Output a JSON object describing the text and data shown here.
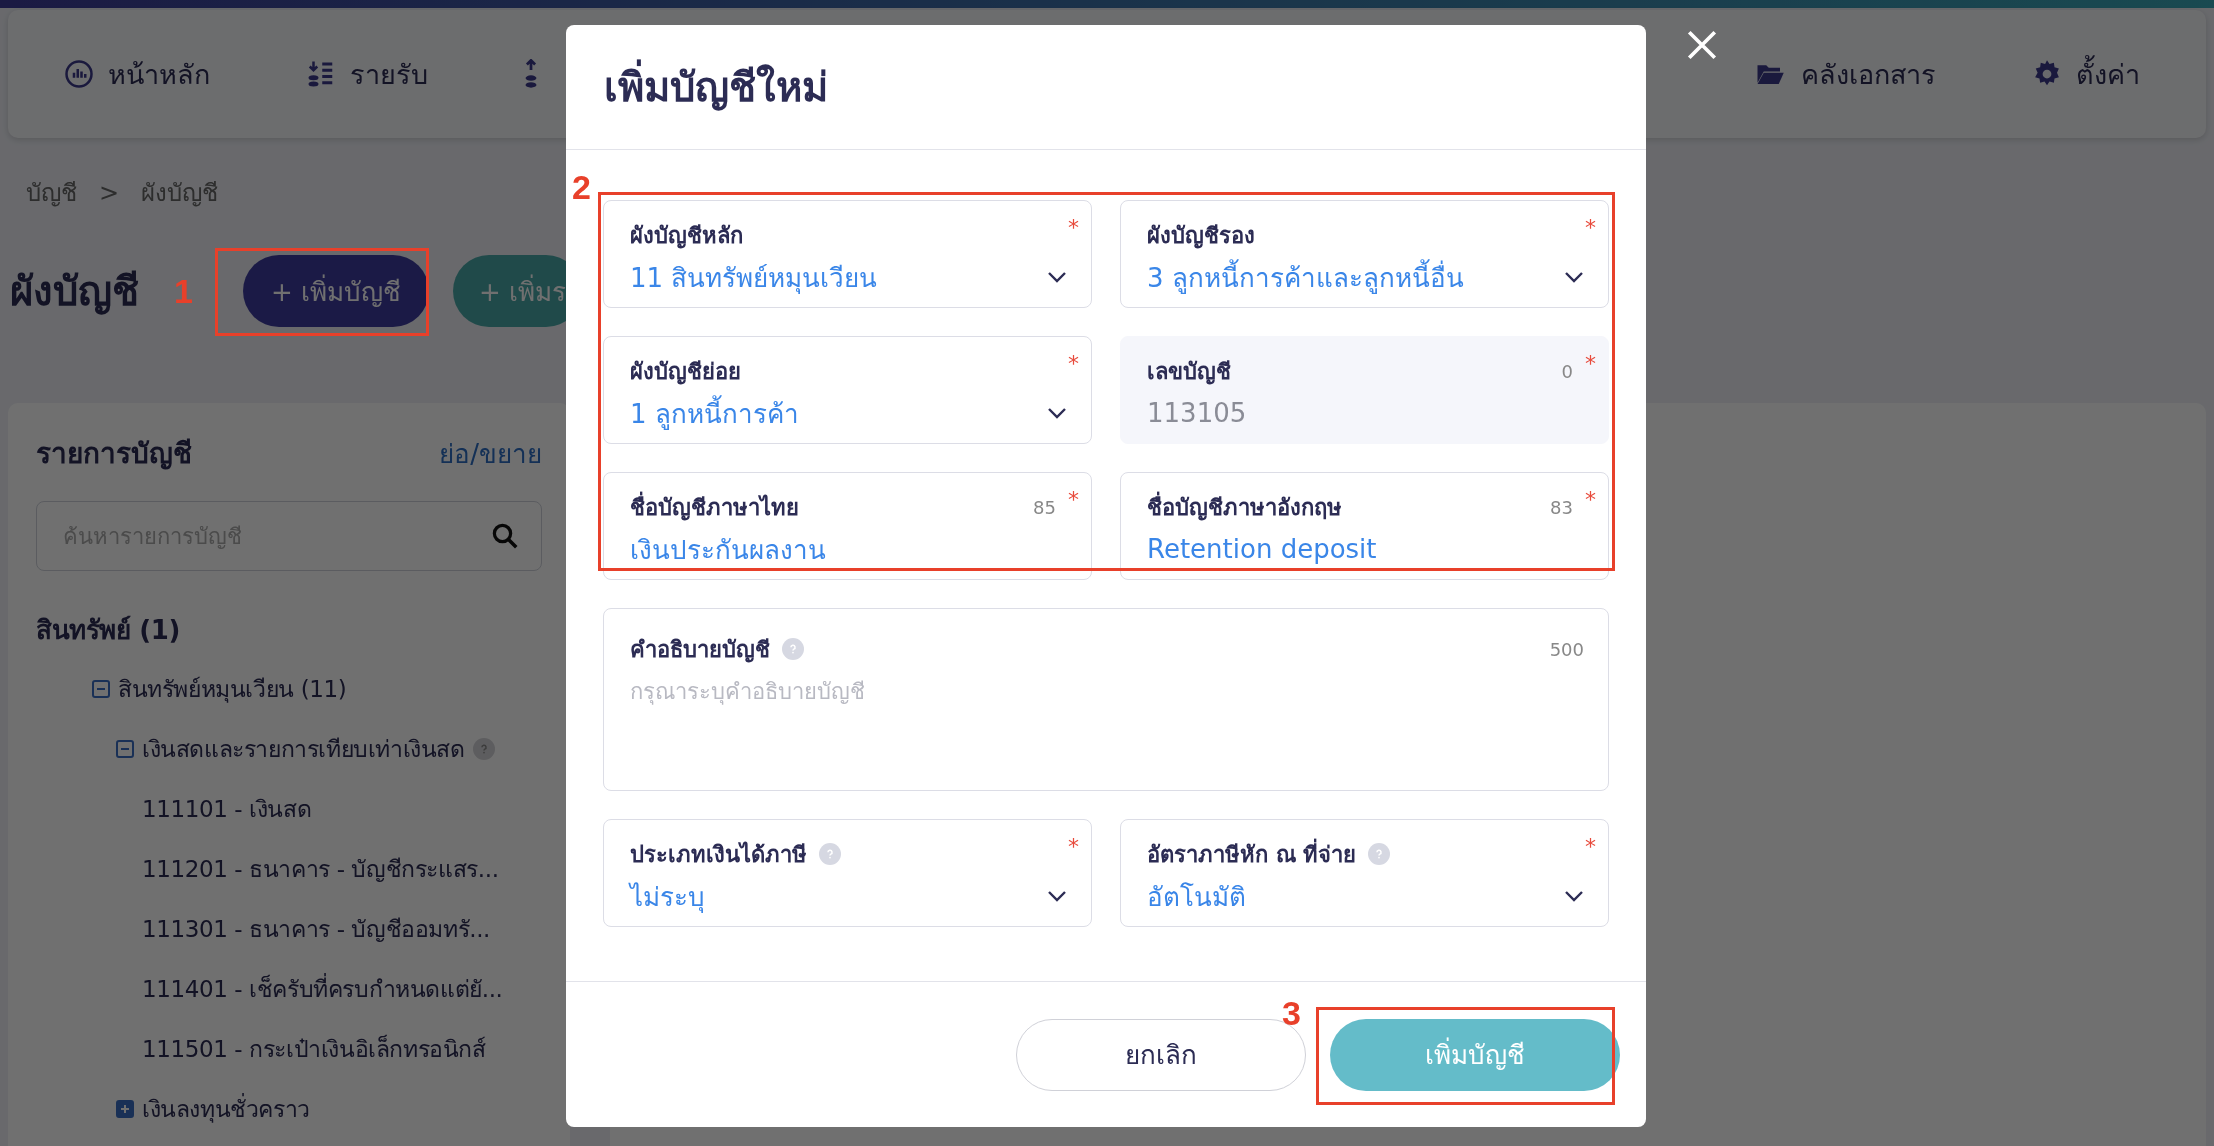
{
  "top_nav": {
    "items": [
      {
        "kind": "home",
        "label": "หน้าหลัก"
      },
      {
        "kind": "income",
        "label": "รายรับ"
      },
      {
        "kind": "expense"
      },
      {
        "kind": "documents",
        "label": "คลังเอกสาร"
      },
      {
        "kind": "settings",
        "label": "ตั้งค่า"
      }
    ]
  },
  "breadcrumb": [
    "บัญชี",
    ">",
    "ผังบัญชี"
  ],
  "page_title": "ผังบัญชี",
  "page_buttons": [
    {
      "kind": "primary",
      "label": "+ เพิ่มบัญชี"
    },
    {
      "kind": "teal",
      "label": "+ เพิ่มร"
    }
  ],
  "account_list": {
    "title": "รายการบัญชี",
    "toggle_link": "ย่อ/ขยาย",
    "search": {
      "placeholder": "ค้นหารายการบัญชี"
    },
    "tree": [
      {
        "label": "สินทรัพย์ (1)",
        "children": [
          {
            "label": "สินทรัพย์หมุนเวียน (11)",
            "expanded": true,
            "children": [
              {
                "label": "เงินสดและรายการเทียบเท่าเงินสด",
                "expanded": true,
                "help": true,
                "children": [
                  {
                    "label": "111101 - เงินสด"
                  },
                  {
                    "label": "111201 - ธนาคาร - บัญชีกระแสร..."
                  },
                  {
                    "label": "111301 - ธนาคาร - บัญชีออมทรั..."
                  },
                  {
                    "label": "111401 - เช็ครับที่ครบกำหนดแต่ยั..."
                  },
                  {
                    "label": "111501 - กระเป๋าเงินอิเล็กทรอนิกส์"
                  }
                ]
              },
              {
                "label": "เงินลงทุนชั่วคราว",
                "expanded": false
              }
            ]
          }
        ]
      }
    ]
  },
  "dialog": {
    "title": "เพิ่มบัญชีใหม่",
    "fields": [
      {
        "kind": "select",
        "label": "ผังบัญชีหลัก",
        "value": "11 สินทรัพย์หมุนเวียน",
        "required_mark": "*"
      },
      {
        "kind": "select",
        "label": "ผังบัญชีรอง",
        "value": "3 ลูกหนี้การค้าและลูกหนี้อื่น",
        "required_mark": "*"
      },
      {
        "kind": "select",
        "label": "ผังบัญชีย่อย",
        "value": "1 ลูกหนี้การค้า",
        "required_mark": "*"
      },
      {
        "kind": "readonly",
        "label": "เลขบัญชี",
        "counter": "0",
        "value": "113105",
        "required_mark": "*"
      },
      {
        "kind": "text",
        "label": "ชื่อบัญชีภาษาไทย",
        "counter": "85",
        "value": "เงินประกันผลงาน",
        "required_mark": "*"
      },
      {
        "kind": "text",
        "label": "ชื่อบัญชีภาษาอังกฤษ",
        "counter": "83",
        "value": "Retention deposit",
        "required_mark": "*"
      },
      {
        "kind": "textarea",
        "label": "คำอธิบายบัญชี",
        "help": true,
        "counter": "500",
        "placeholder": "กรุณาระบุคำอธิบายบัญชี"
      },
      {
        "kind": "select",
        "label": "ประเภทเงินได้ภาษี",
        "help": true,
        "value": "ไม่ระบุ",
        "required_mark": "*"
      },
      {
        "kind": "select",
        "label": "อัตราภาษีหัก ณ ที่จ่าย",
        "help": true,
        "value": "อัตโนมัติ",
        "required_mark": "*"
      }
    ],
    "buttons": [
      {
        "kind": "secondary",
        "label": "ยกเลิก"
      },
      {
        "kind": "primary",
        "label": "เพิ่มบัญชี"
      }
    ]
  },
  "annotations": [
    {
      "label": "1"
    },
    {
      "label": "2"
    },
    {
      "label": "3"
    }
  ]
}
